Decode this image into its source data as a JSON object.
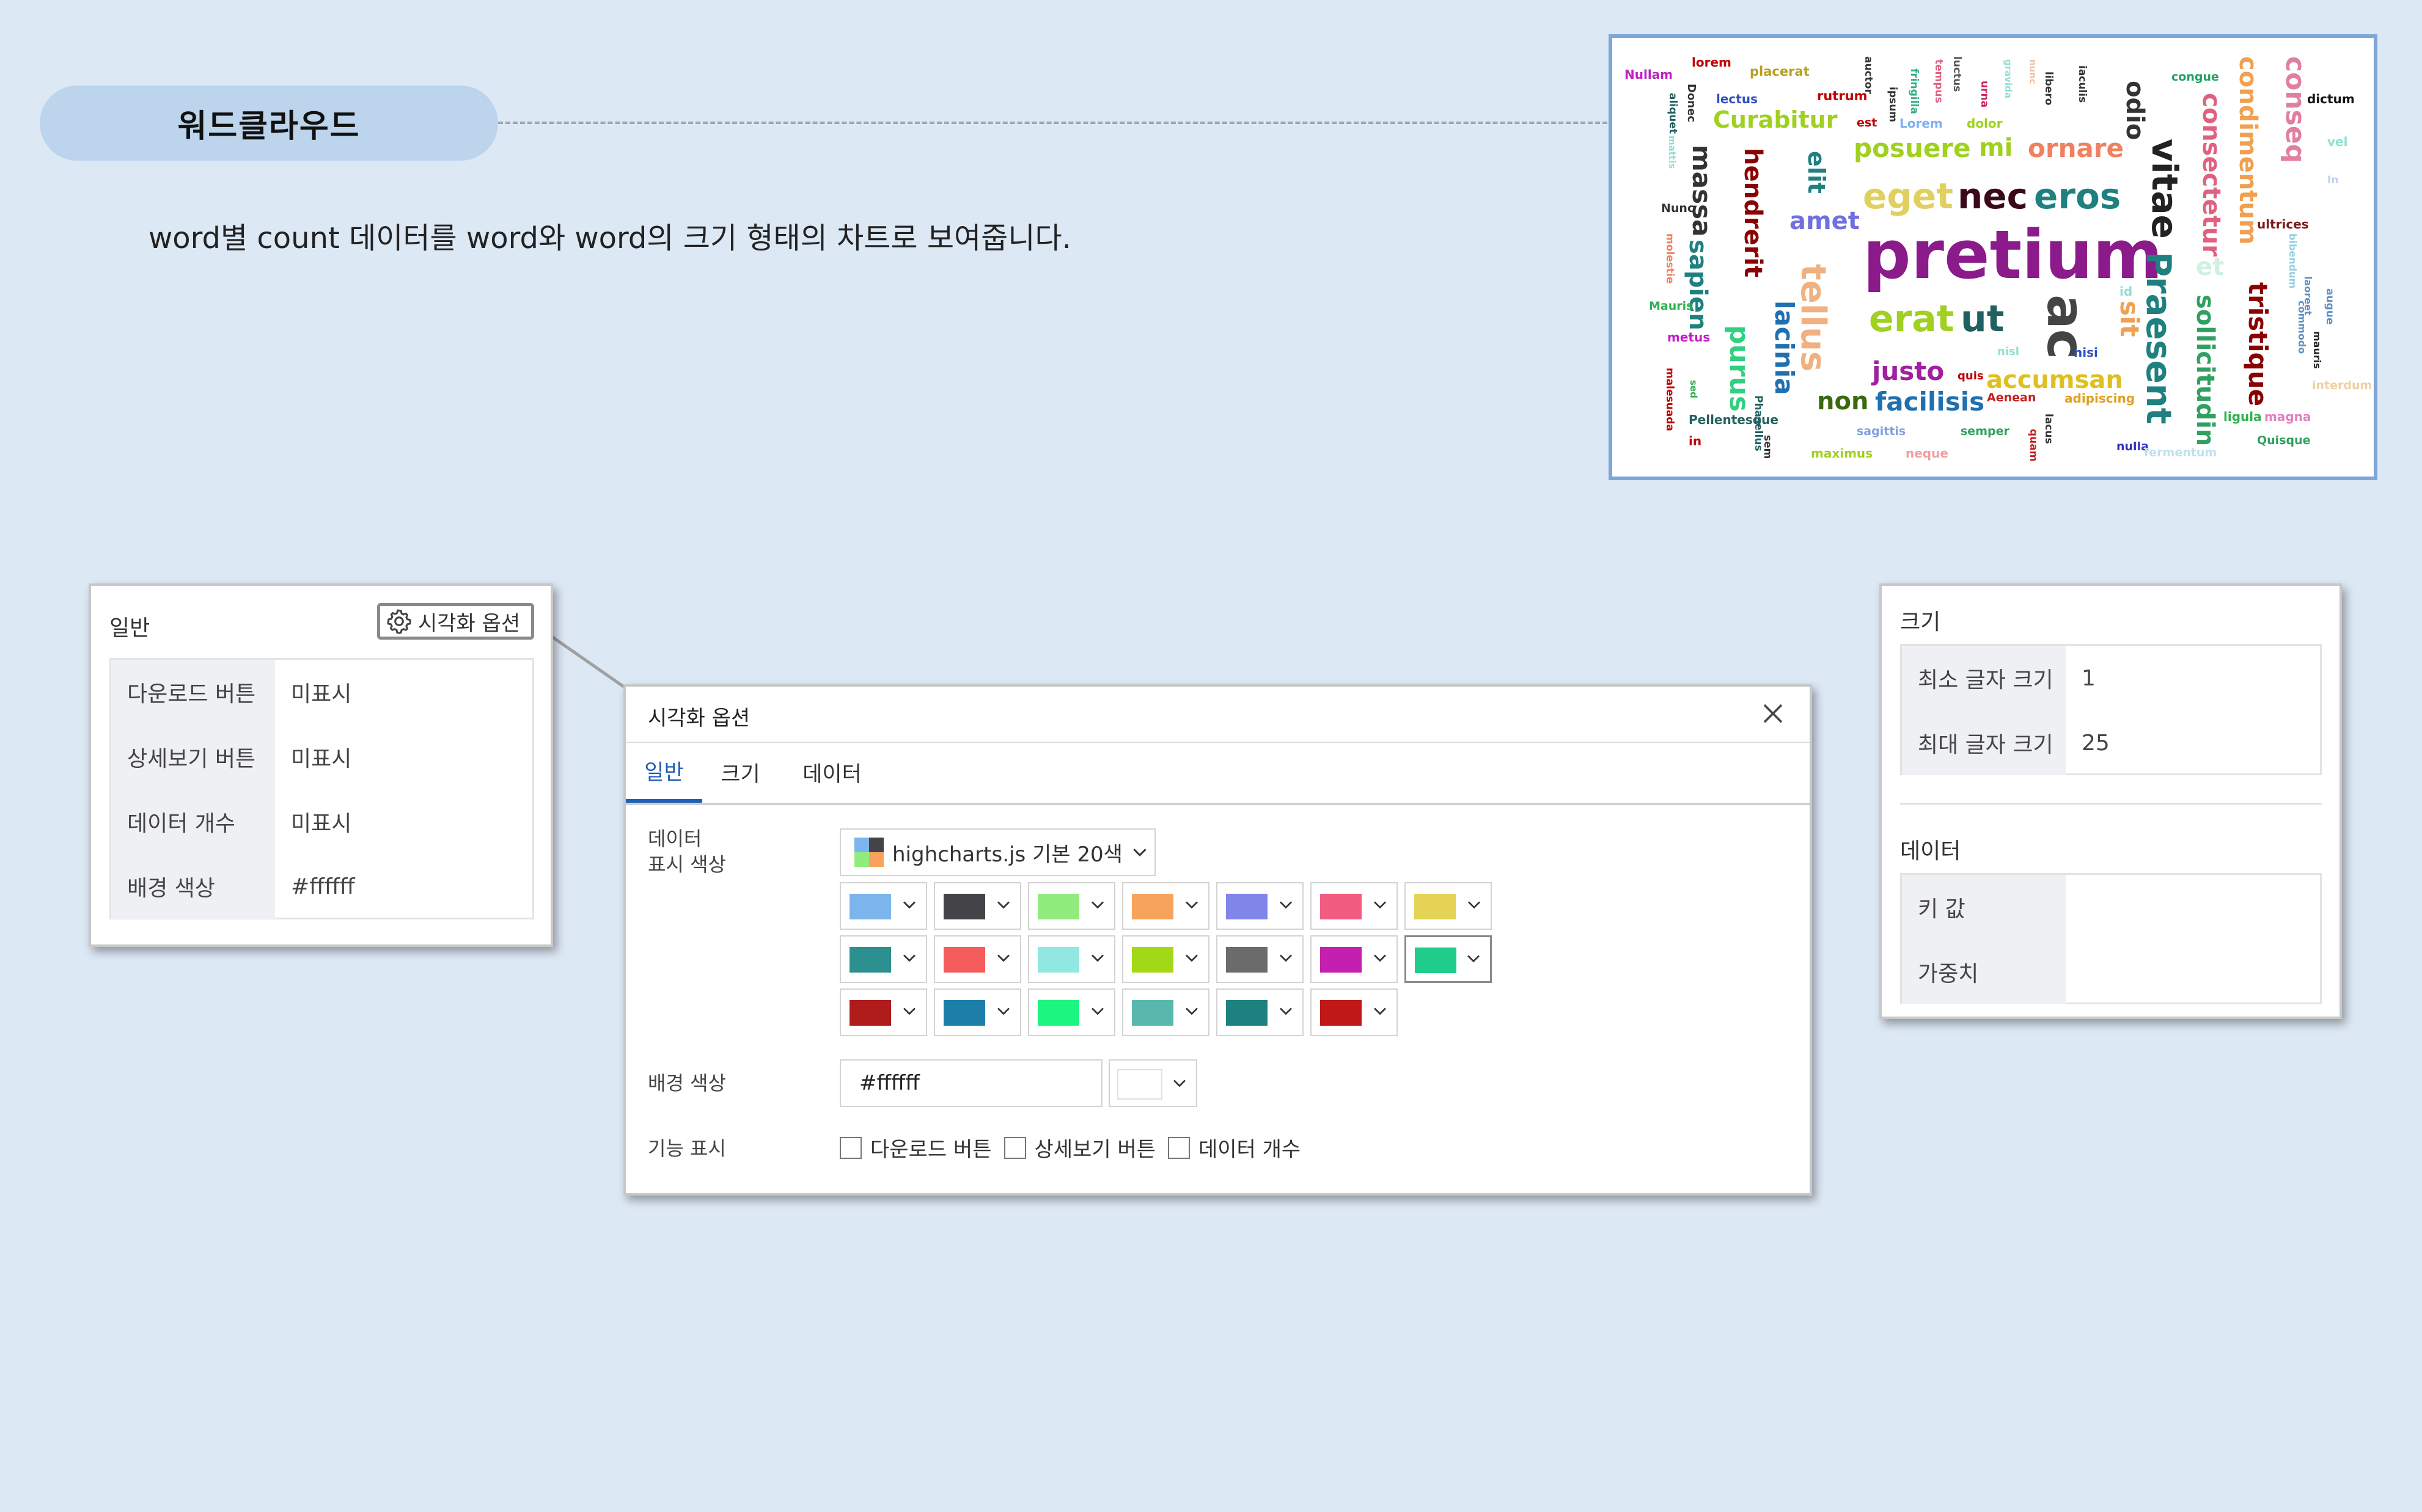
{
  "header": {
    "title": "워드클라우드",
    "description": "word별 count 데이터를 word와 word의 크기 형태의 차트로 보여줍니다."
  },
  "cloud": {
    "words": [
      {
        "t": "lorem",
        "c": "#c00000"
      },
      {
        "t": "Nullam",
        "c": "#c020c0"
      },
      {
        "t": "Donec",
        "c": "#333333"
      },
      {
        "t": "placerat",
        "c": "#b8a020"
      },
      {
        "t": "lectus",
        "c": "#3050c0"
      },
      {
        "t": "rutrum",
        "c": "#c00000"
      },
      {
        "t": "auctor",
        "c": "#333333"
      },
      {
        "t": "fringilla",
        "c": "#30b080"
      },
      {
        "t": "tempus",
        "c": "#e06080"
      },
      {
        "t": "ipsum",
        "c": "#333333"
      },
      {
        "t": "luctus",
        "c": "#555555"
      },
      {
        "t": "urna",
        "c": "#d02060"
      },
      {
        "t": "gravida",
        "c": "#90e0d0"
      },
      {
        "t": "nunc",
        "c": "#f0c0a0"
      },
      {
        "t": "libero",
        "c": "#333333"
      },
      {
        "t": "iaculis",
        "c": "#333333"
      },
      {
        "t": "odio",
        "c": "#333333"
      },
      {
        "t": "congue",
        "c": "#20a060"
      },
      {
        "t": "conseq",
        "c": "#e080a0"
      },
      {
        "t": "dictum",
        "c": "#111111"
      },
      {
        "t": "Curabitur",
        "c": "#a0d020"
      },
      {
        "t": "est",
        "c": "#c00000"
      },
      {
        "t": "Lorem",
        "c": "#80b0f0"
      },
      {
        "t": "dolor",
        "c": "#a0d020"
      },
      {
        "t": "aliquet",
        "c": "#206060"
      },
      {
        "t": "mattis",
        "c": "#90e0d0"
      },
      {
        "t": "massa",
        "c": "#333333"
      },
      {
        "t": "hendrerit",
        "c": "#8b0000"
      },
      {
        "t": "elit",
        "c": "#208080"
      },
      {
        "t": "posuere",
        "c": "#a0d020"
      },
      {
        "t": "mi",
        "c": "#a0d020"
      },
      {
        "t": "ornare",
        "c": "#f08060"
      },
      {
        "t": "vitae",
        "c": "#222222"
      },
      {
        "t": "consectetur",
        "c": "#e06080"
      },
      {
        "t": "condimentum",
        "c": "#f0a050"
      },
      {
        "t": "Nunc",
        "c": "#333333"
      },
      {
        "t": "amet",
        "c": "#7070e0"
      },
      {
        "t": "eget",
        "c": "#e0d060"
      },
      {
        "t": "nec",
        "c": "#3a0a1a"
      },
      {
        "t": "eros",
        "c": "#208080"
      },
      {
        "t": "ultrices",
        "c": "#7a1a1a"
      },
      {
        "t": "molestie",
        "c": "#f08060"
      },
      {
        "t": "sapien",
        "c": "#208080"
      },
      {
        "t": "pretium",
        "c": "#8b1a8b"
      },
      {
        "t": "Praesent",
        "c": "#208080"
      },
      {
        "t": "et",
        "c": "#d0f0e0"
      },
      {
        "t": "Mauris",
        "c": "#30b050"
      },
      {
        "t": "tellus",
        "c": "#f0b080"
      },
      {
        "t": "erat",
        "c": "#a0d020"
      },
      {
        "t": "ut",
        "c": "#206060"
      },
      {
        "t": "ac",
        "c": "#444444"
      },
      {
        "t": "sit",
        "c": "#f0a050"
      },
      {
        "t": "sollicitudin",
        "c": "#30a060"
      },
      {
        "t": "tristique",
        "c": "#8b0000"
      },
      {
        "t": "metus",
        "c": "#c020c0"
      },
      {
        "t": "purus",
        "c": "#30d080"
      },
      {
        "t": "lacinia",
        "c": "#2070b0"
      },
      {
        "t": "nisl",
        "c": "#90e0d0"
      },
      {
        "t": "nisi",
        "c": "#3050c0"
      },
      {
        "t": "justo",
        "c": "#a020a0"
      },
      {
        "t": "quis",
        "c": "#c00000"
      },
      {
        "t": "accumsan",
        "c": "#e0c020"
      },
      {
        "t": "malesuada",
        "c": "#c00000"
      },
      {
        "t": "sed",
        "c": "#30b050"
      },
      {
        "t": "Pellentesque",
        "c": "#206060"
      },
      {
        "t": "Phasellus",
        "c": "#206060"
      },
      {
        "t": "non",
        "c": "#3a6a10"
      },
      {
        "t": "facilisis",
        "c": "#2070b0"
      },
      {
        "t": "Aenean",
        "c": "#c02020"
      },
      {
        "t": "adipiscing",
        "c": "#e0a020"
      },
      {
        "t": "ligula",
        "c": "#30b050"
      },
      {
        "t": "magna",
        "c": "#e080c0"
      },
      {
        "t": "sagittis",
        "c": "#80a0e0"
      },
      {
        "t": "semper",
        "c": "#30a060"
      },
      {
        "t": "lacus",
        "c": "#333333"
      },
      {
        "t": "Quisque",
        "c": "#30a060"
      },
      {
        "t": "in",
        "c": "#c00000"
      },
      {
        "t": "sem",
        "c": "#333333"
      },
      {
        "t": "maximus",
        "c": "#a0d020"
      },
      {
        "t": "neque",
        "c": "#f0a0a0"
      },
      {
        "t": "quam",
        "c": "#c02020"
      },
      {
        "t": "nulla",
        "c": "#3030c0"
      },
      {
        "t": "fermentum",
        "c": "#c0e0f0"
      },
      {
        "t": "mauris",
        "c": "#222222"
      },
      {
        "t": "interdum",
        "c": "#f0d0a0"
      },
      {
        "t": "bibendum",
        "c": "#90d0e0"
      },
      {
        "t": "commodo",
        "c": "#6090c0"
      },
      {
        "t": "laoreet",
        "c": "#6090c0"
      },
      {
        "t": "augue",
        "c": "#6090c0"
      },
      {
        "t": "vel",
        "c": "#90e0d0"
      },
      {
        "t": "In",
        "c": "#c0d0f0"
      },
      {
        "t": "id",
        "c": "#90e0d0"
      }
    ]
  },
  "general_panel": {
    "title": "일반",
    "vis_button": "시각화 옵션",
    "rows": [
      {
        "label": "다운로드 버튼",
        "value": "미표시"
      },
      {
        "label": "상세보기 버튼",
        "value": "미표시"
      },
      {
        "label": "데이터 개수",
        "value": "미표시"
      },
      {
        "label": "배경 색상",
        "value": "#ffffff"
      }
    ]
  },
  "dialog": {
    "title": "시각화 옵션",
    "tabs": [
      "일반",
      "크기",
      "데이터"
    ],
    "active_tab": "일반",
    "data_color_label": "데이터\n표시 색상",
    "palette_name": "highcharts.js 기본 20색",
    "swatches": [
      "#7cb5ec",
      "#434348",
      "#90ed7d",
      "#f7a35c",
      "#8085e9",
      "#f15c80",
      "#e4d354",
      "#2b908f",
      "#f45b5b",
      "#91e8e1",
      "#a2d815",
      "#6b6b6b",
      "#c41fb0",
      "#1fcc8c",
      "#b01c1c",
      "#1d7fa8",
      "#1cf580",
      "#59b8ae",
      "#1f8080",
      "#c01818"
    ],
    "bg_label": "배경 색상",
    "bg_value": "#ffffff",
    "feature_label": "기능 표시",
    "checkboxes": [
      "다운로드 버튼",
      "상세보기 버튼",
      "데이터 개수"
    ]
  },
  "right_panel": {
    "size_title": "크기",
    "size_rows": [
      {
        "label": "최소 글자 크기",
        "value": "1"
      },
      {
        "label": "최대 글자 크기",
        "value": "25"
      }
    ],
    "data_title": "데이터",
    "data_rows": [
      {
        "label": "키 값",
        "value": ""
      },
      {
        "label": "가중치",
        "value": ""
      }
    ]
  }
}
